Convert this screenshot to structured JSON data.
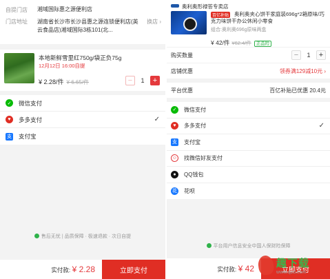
{
  "left": {
    "address": {
      "pickup_label": "自提门店",
      "pickup_store": "湘域国际惠之源便利店",
      "addr_label": "门店地址",
      "addr_value": "湖南省长沙市长沙县惠之源连锁便利店(英云食品店)湘域国际3栋101(北...",
      "change_label": "换店 ›"
    },
    "product": {
      "name": "本地新鲜雪里红750g/袋正负75g",
      "pickup_time": "12月12日 16:00自提",
      "price": "¥ 2.28/件",
      "orig_price": "¥ 6.65/件",
      "qty": "1",
      "minus": "−",
      "plus": "+"
    },
    "payments": [
      {
        "label": "微信支付",
        "icon": "wechat-pay-icon",
        "checked": false
      },
      {
        "label": "多多支付",
        "icon": "duoduo-pay-icon",
        "checked": true
      },
      {
        "label": "支付宝",
        "icon": "alipay-icon",
        "checked": false
      }
    ],
    "check_mark": "✓",
    "guarantee": "售后无忧 | 品质保障 · 极速退款 · 次日自提",
    "total_label": "实付款:",
    "total_value": "¥ 2.28",
    "pay_button": "立即支付"
  },
  "right": {
    "shop": {
      "name": "奥利奥形禄答专卖店",
      "badge": "百亿补贴",
      "product_name": "奥利奥夹心饼干家庭装696g*2箱原味/巧克力味饼干办公休闲小零食",
      "spec": "组合:奥利奥696g原味两盒",
      "price": "¥ 42/件",
      "orig_price": "¥62.4/件",
      "genuine": "正品险"
    },
    "quantity_label": "购买数量",
    "qty": "1",
    "minus": "−",
    "plus": "+",
    "store_discount_label": "店铺优惠",
    "store_discount_value": "领券满129减10元 ›",
    "platform_label": "平台优惠",
    "platform_value": "百亿补贴已优惠 20.4元",
    "payments": [
      {
        "label": "微信支付",
        "icon": "wechat-pay-icon",
        "checked": false
      },
      {
        "label": "多多支付",
        "icon": "duoduo-pay-icon",
        "checked": true
      },
      {
        "label": "支付宝",
        "icon": "alipay-icon",
        "checked": false
      },
      {
        "label": "找微信好友支付",
        "icon": "friend-pay-icon",
        "checked": false
      },
      {
        "label": "QQ钱包",
        "icon": "qq-wallet-icon",
        "checked": false
      },
      {
        "label": "花呗",
        "icon": "huabei-icon",
        "checked": false
      }
    ],
    "check_mark": "✓",
    "guarantee": "平台用户信息安全中国人保财险保障",
    "total_label": "实付款:",
    "total_value": "¥ 42",
    "pay_button": "立即支付"
  },
  "watermark": {
    "title": "趣下载",
    "url": "www.qzd.com"
  },
  "colors": {
    "accent": "#e02e24",
    "wechat": "#09bb07",
    "alipay": "#1677ff",
    "genuine": "#2fb24a"
  }
}
